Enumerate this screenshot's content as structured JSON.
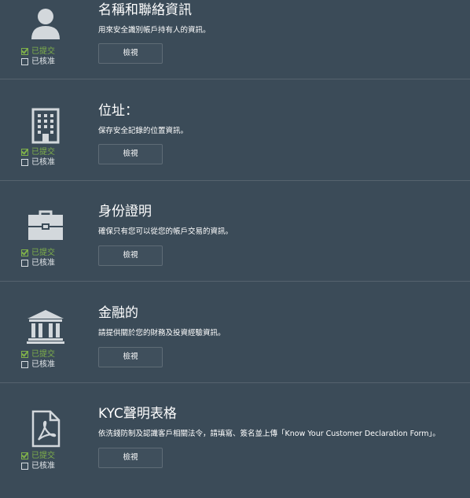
{
  "sections": [
    {
      "title": "名稱和聯絡資訊",
      "description": "用來安全識別帳戶持有人的資訊。",
      "icon": "user-icon",
      "status_submitted": "已提交",
      "status_approved": "已核准",
      "submitted": true,
      "approved": false,
      "button_label": "檢視"
    },
    {
      "title": "位址：",
      "description": "保存安全記錄的位置資訊。",
      "icon": "building-icon",
      "status_submitted": "已提交",
      "status_approved": "已核准",
      "submitted": true,
      "approved": false,
      "button_label": "檢視"
    },
    {
      "title": "身份證明",
      "description": "確保只有您可以從您的帳戶交易的資訊。",
      "icon": "briefcase-icon",
      "status_submitted": "已提交",
      "status_approved": "已核准",
      "submitted": true,
      "approved": false,
      "button_label": "檢視"
    },
    {
      "title": "金融的",
      "description": "請提供關於您的財務及投資經驗資訊。",
      "icon": "bank-icon",
      "status_submitted": "已提交",
      "status_approved": "已核准",
      "submitted": true,
      "approved": false,
      "button_label": "檢視"
    },
    {
      "title": "KYC聲明表格",
      "description": "依洗錢防制及認識客戶相關法令，請填寫、簽名並上傳「Know Your Customer Declaration Form」。",
      "icon": "pdf-document-icon",
      "status_submitted": "已提交",
      "status_approved": "已核准",
      "submitted": true,
      "approved": false,
      "button_label": "檢視"
    }
  ],
  "colors": {
    "background": "#3b4b58",
    "submitted_green": "#7fb04a",
    "icon_gray": "#d3d8dc",
    "divider": "#56636e"
  }
}
